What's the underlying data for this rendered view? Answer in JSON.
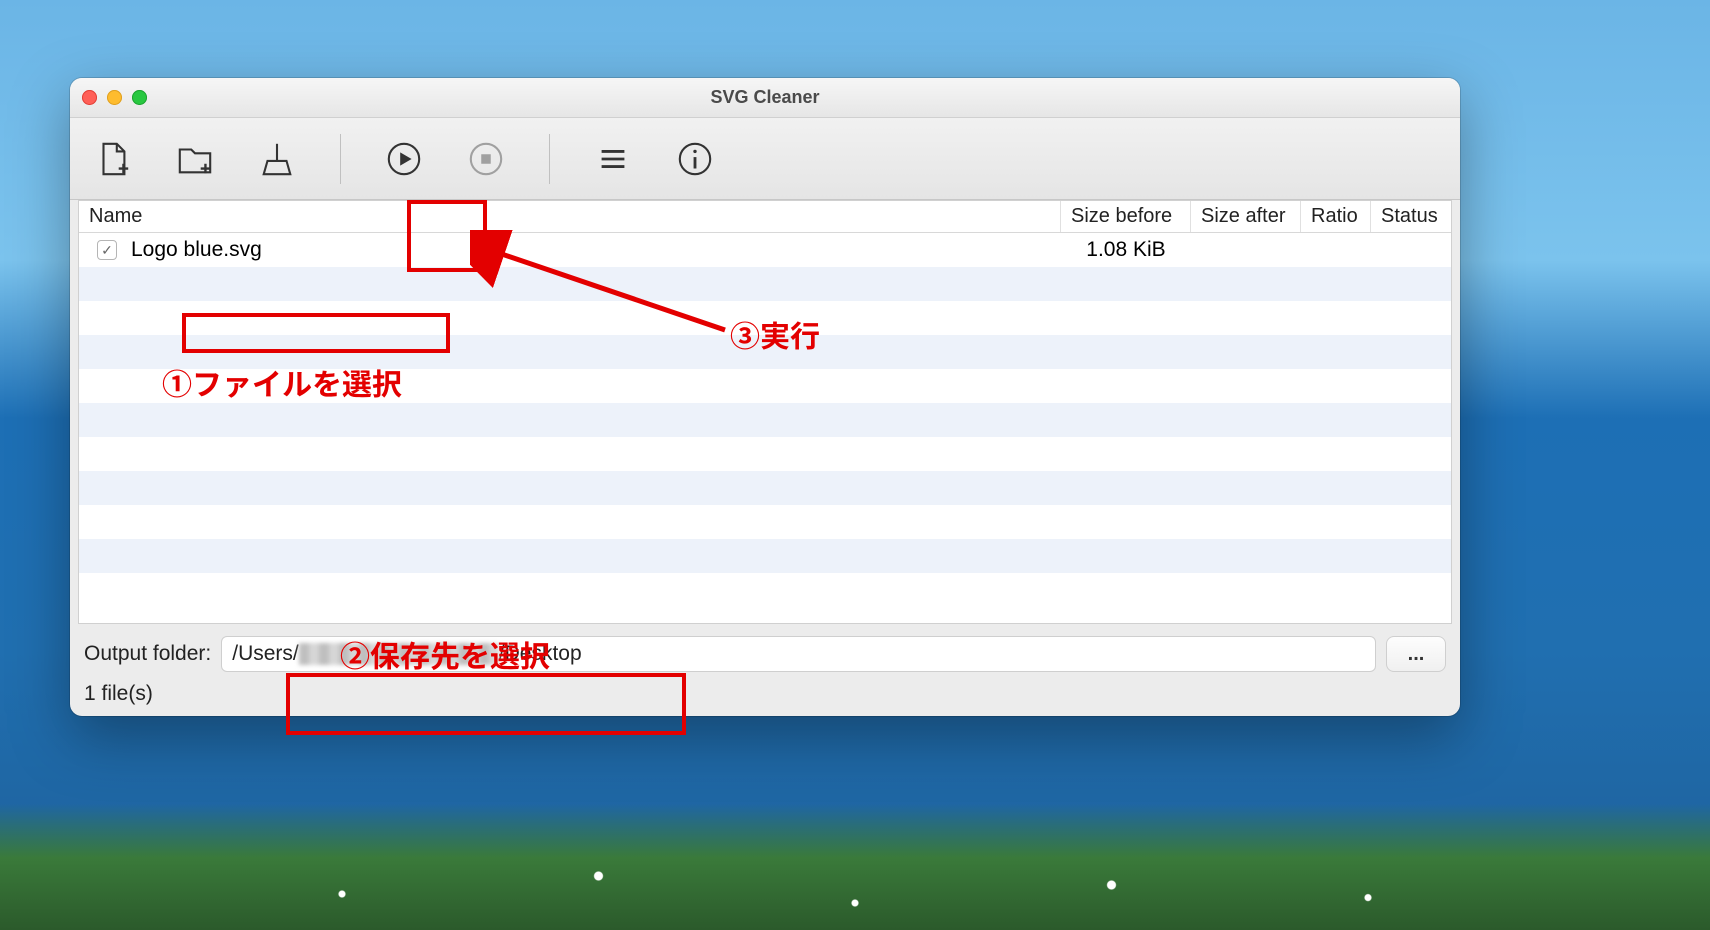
{
  "window": {
    "title": "SVG Cleaner"
  },
  "toolbar": {
    "add_file": "add-file",
    "add_folder": "add-folder",
    "broom": "clean",
    "play": "run",
    "stop": "stop",
    "menu": "menu",
    "info": "info"
  },
  "columns": {
    "name": "Name",
    "size_before": "Size before",
    "size_after": "Size after",
    "ratio": "Ratio",
    "status": "Status"
  },
  "files": [
    {
      "checked": true,
      "name": "Logo blue.svg",
      "size_before": "1.08 KiB",
      "size_after": "",
      "ratio": "",
      "status": ""
    }
  ],
  "output": {
    "label": "Output folder:",
    "value_prefix": "/Users/",
    "value_suffix": "/Desktop",
    "browse": "..."
  },
  "statusbar": "1 file(s)",
  "annotations": {
    "step1": "①ファイルを選択",
    "step2": "②保存先を選択",
    "step3": "③実行"
  }
}
